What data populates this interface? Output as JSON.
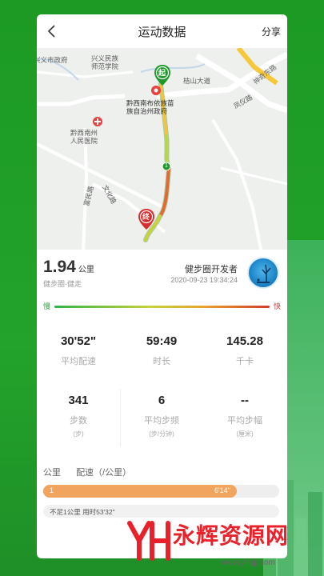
{
  "nav": {
    "title": "运动数据",
    "share": "分享"
  },
  "map": {
    "labels": {
      "gov": "兴义市政府",
      "normal_school": "兴义民族\n师范学院",
      "shenqi_rd": "神奇东路",
      "guishan_ave": "桔山大道",
      "fengyi_rd": "凤仪路",
      "pref_gov": "黔西南布依族苗\n族自治州政府",
      "hospital": "黔西南州\n人民医院",
      "fumin_rd": "富民路",
      "wenhua_rd": "文化路"
    },
    "start_marker": "起",
    "end_marker": "终",
    "km_marker": "1"
  },
  "summary": {
    "distance": "1.94",
    "distance_unit": "公里",
    "activity_type": "健步圈·健走",
    "user_name": "健步圈开发者",
    "time": "2020-09-23 19:34:24"
  },
  "speed_legend": {
    "slow": "慢",
    "fast": "快"
  },
  "stats": [
    {
      "value": "30'52\"",
      "label": "平均配速",
      "sub": ""
    },
    {
      "value": "59:49",
      "label": "时长",
      "sub": ""
    },
    {
      "value": "145.28",
      "label": "千卡",
      "sub": ""
    },
    {
      "value": "341",
      "label": "步数",
      "sub": "(步)"
    },
    {
      "value": "6",
      "label": "平均步频",
      "sub": "(步/分钟)"
    },
    {
      "value": "--",
      "label": "平均步幅",
      "sub": "(厘米)"
    }
  ],
  "pace_section": {
    "km_label": "公里",
    "pace_label": "配速（/公里）",
    "rows": [
      {
        "km": "1",
        "pace": "6'14\"",
        "fill_fraction": 0.82
      }
    ],
    "note": "不足1公里 用时53'32\""
  },
  "watermark": {
    "text": "永辉资源网",
    "url": "www.yhkjjj.com",
    "logo_letters": "YH"
  },
  "colors": {
    "brand_green": "#1f9a2a",
    "pace_orange": "#f0a45e",
    "end_red": "#d62d2d"
  }
}
